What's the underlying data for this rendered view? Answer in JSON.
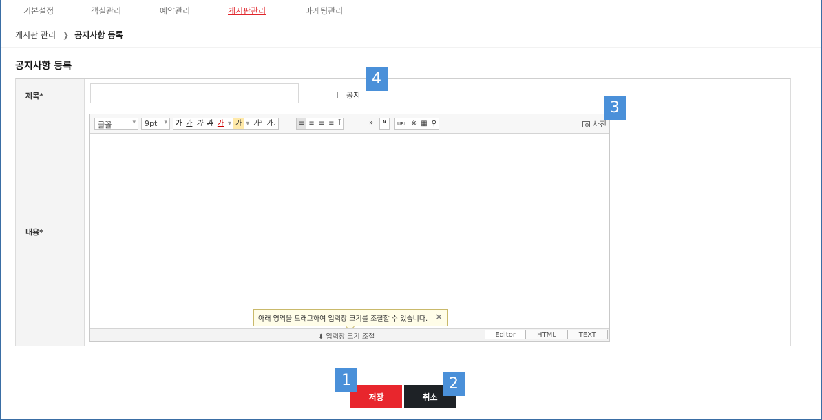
{
  "nav": {
    "items": [
      {
        "label": "기본설정",
        "active": false
      },
      {
        "label": "객실관리",
        "active": false
      },
      {
        "label": "예약관리",
        "active": false
      },
      {
        "label": "게시판관리",
        "active": true
      },
      {
        "label": "마케팅관리",
        "active": false
      }
    ]
  },
  "breadcrumb": {
    "parent": "게시판 관리",
    "current": "공지사항 등록"
  },
  "page_title": "공지사항 등록",
  "form": {
    "title_label": "제목*",
    "title_value": "",
    "notice_checkbox_label": "공지",
    "notice_checked": false,
    "content_label": "내용*"
  },
  "editor": {
    "font_select": "글꼴",
    "size_select": "9pt",
    "photo_label": "사진",
    "resize_tooltip": "아래 영역을 드래그하여 입력창 크기를 조절할 수 있습니다.",
    "resize_handle": "⬍ 입력창 크기 조절",
    "mode_tabs": [
      "Editor",
      "HTML",
      "TEXT"
    ],
    "active_mode": "Editor"
  },
  "buttons": {
    "save": "저장",
    "cancel": "취소"
  },
  "markers": [
    "1",
    "2",
    "3",
    "4"
  ],
  "colors": {
    "accent_red": "#e8262d",
    "dark": "#1e2226",
    "marker_blue": "#4a90d9"
  }
}
